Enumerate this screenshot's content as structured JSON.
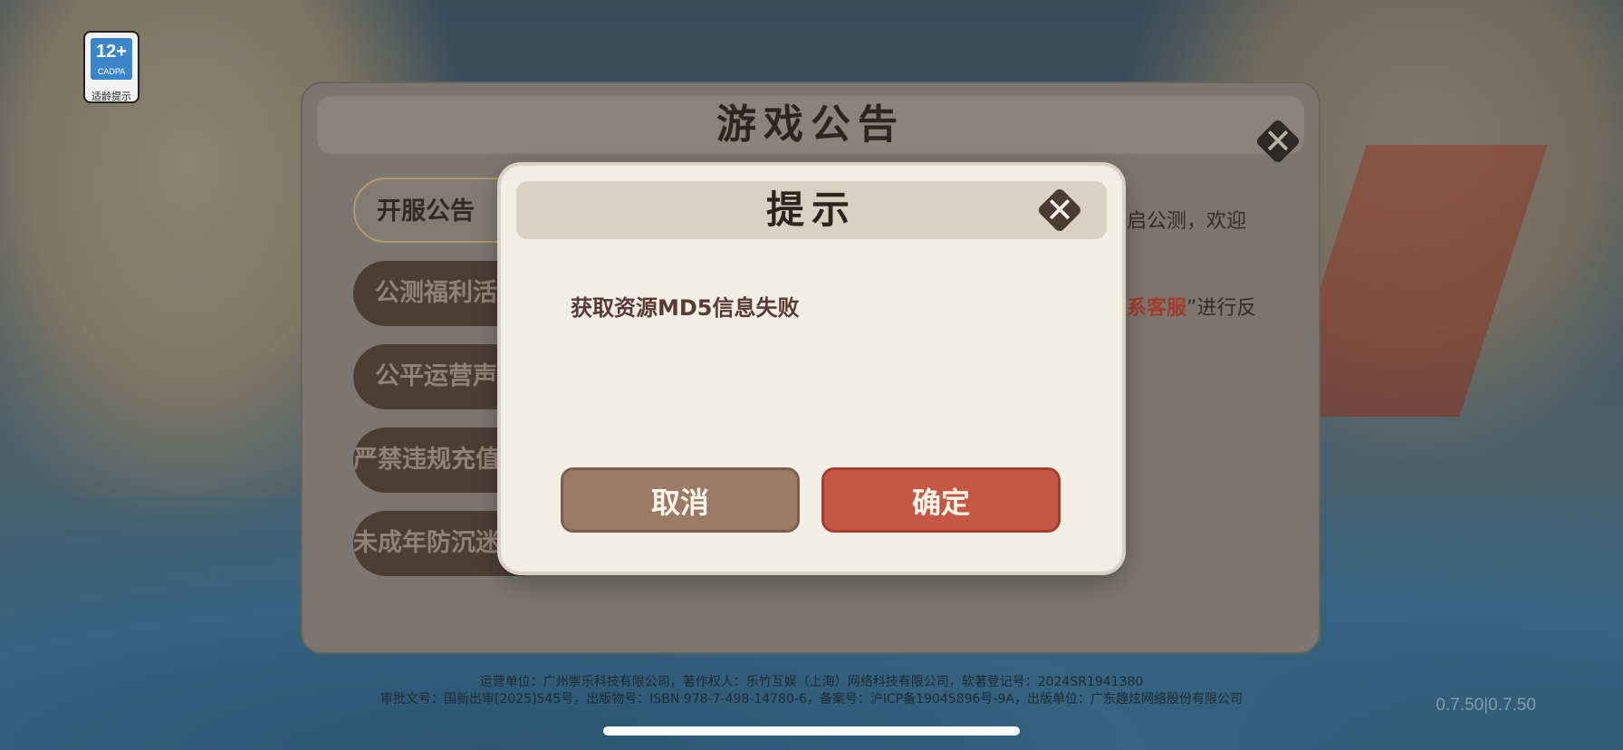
{
  "age_rating": {
    "number": "12+",
    "org": "CADPA",
    "tip": "适龄提示"
  },
  "notice_panel": {
    "title": "游戏公告",
    "tabs": [
      "开服公告",
      "公测福利活动",
      "公平运营声明",
      "严禁违规充值",
      "未成年防沉迷"
    ],
    "content_line1": "开启公测，欢迎",
    "content_line2_highlight": "联系客服",
    "content_line2_rest": "”进行反"
  },
  "footer": {
    "line1": "运营单位：广州崇乐科技有限公司，著作权人：乐竹互娱（上海）网络科技有限公司，软著登记号：2024SR1941380",
    "line2": "审批文号：国新出审[2025]545号，出版物号：ISBN 978-7-498-14780-6，备案号：沪ICP备19045896号-9A，出版单位：广东趣炫网络股份有限公司"
  },
  "version": "0.7.50|0.7.50",
  "dialog": {
    "title": "提示",
    "message": "获取资源MD5信息失败",
    "cancel_label": "取消",
    "confirm_label": "确定"
  }
}
